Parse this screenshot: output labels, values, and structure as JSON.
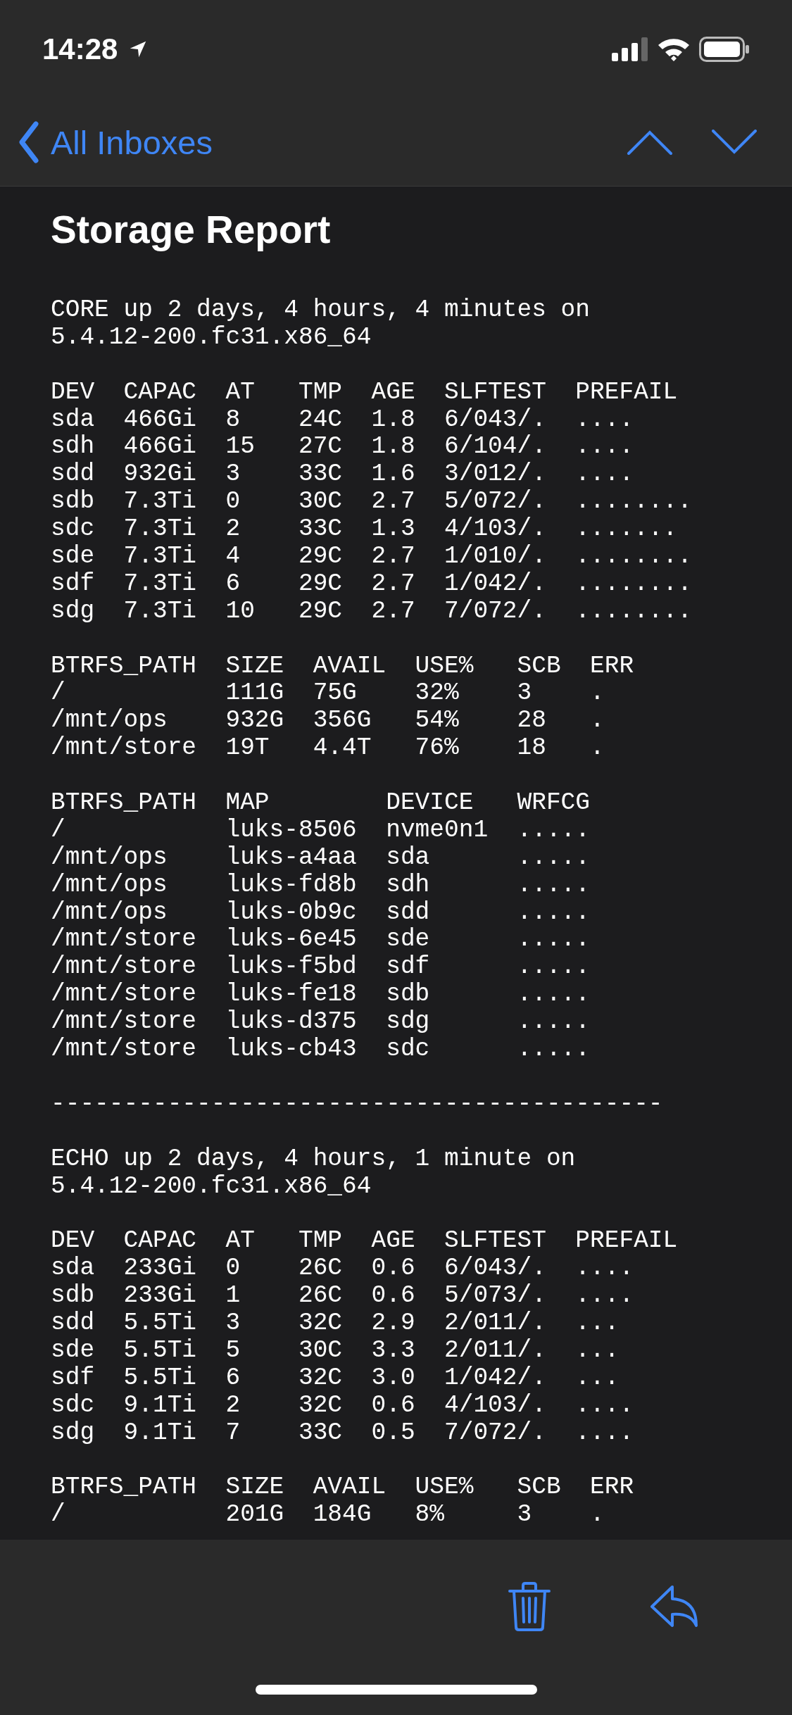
{
  "status_bar": {
    "time": "14:28"
  },
  "nav": {
    "back": "All Inboxes"
  },
  "message": {
    "subject": "Storage Report",
    "blocks": [
      {
        "lines": [
          "CORE up 2 days, 4 hours, 4 minutes on",
          "5.4.12-200.fc31.x86_64"
        ]
      },
      {
        "lines": [
          "DEV  CAPAC  AT   TMP  AGE  SLFTEST  PREFAIL",
          "sda  466Gi  8    24C  1.8  6/043/.  ....",
          "sdh  466Gi  15   27C  1.8  6/104/.  ....",
          "sdd  932Gi  3    33C  1.6  3/012/.  ....",
          "sdb  7.3Ti  0    30C  2.7  5/072/.  ........",
          "sdc  7.3Ti  2    33C  1.3  4/103/.  .......",
          "sde  7.3Ti  4    29C  2.7  1/010/.  ........",
          "sdf  7.3Ti  6    29C  2.7  1/042/.  ........",
          "sdg  7.3Ti  10   29C  2.7  7/072/.  ........"
        ]
      },
      {
        "lines": [
          "BTRFS_PATH  SIZE  AVAIL  USE%   SCB  ERR",
          "/           111G  75G    32%    3    .",
          "/mnt/ops    932G  356G   54%    28   .",
          "/mnt/store  19T   4.4T   76%    18   ."
        ]
      },
      {
        "lines": [
          "BTRFS_PATH  MAP        DEVICE   WRFCG",
          "/           luks-8506  nvme0n1  .....",
          "/mnt/ops    luks-a4aa  sda      .....",
          "/mnt/ops    luks-fd8b  sdh      .....",
          "/mnt/ops    luks-0b9c  sdd      .....",
          "/mnt/store  luks-6e45  sde      .....",
          "/mnt/store  luks-f5bd  sdf      .....",
          "/mnt/store  luks-fe18  sdb      .....",
          "/mnt/store  luks-d375  sdg      .....",
          "/mnt/store  luks-cb43  sdc      ....."
        ]
      },
      {
        "lines": [
          "------------------------------------------"
        ]
      },
      {
        "lines": [
          "ECHO up 2 days, 4 hours, 1 minute on",
          "5.4.12-200.fc31.x86_64"
        ]
      },
      {
        "lines": [
          "DEV  CAPAC  AT   TMP  AGE  SLFTEST  PREFAIL",
          "sda  233Gi  0    26C  0.6  6/043/.  ....",
          "sdb  233Gi  1    26C  0.6  5/073/.  ....",
          "sdd  5.5Ti  3    32C  2.9  2/011/.  ...",
          "sde  5.5Ti  5    30C  3.3  2/011/.  ...",
          "sdf  5.5Ti  6    32C  3.0  1/042/.  ...",
          "sdc  9.1Ti  2    32C  0.6  4/103/.  ....",
          "sdg  9.1Ti  7    33C  0.5  7/072/.  ...."
        ]
      },
      {
        "lines": [
          "BTRFS_PATH  SIZE  AVAIL  USE%   SCB  ERR",
          "/           201G  184G   8%     3    ."
        ]
      }
    ]
  }
}
